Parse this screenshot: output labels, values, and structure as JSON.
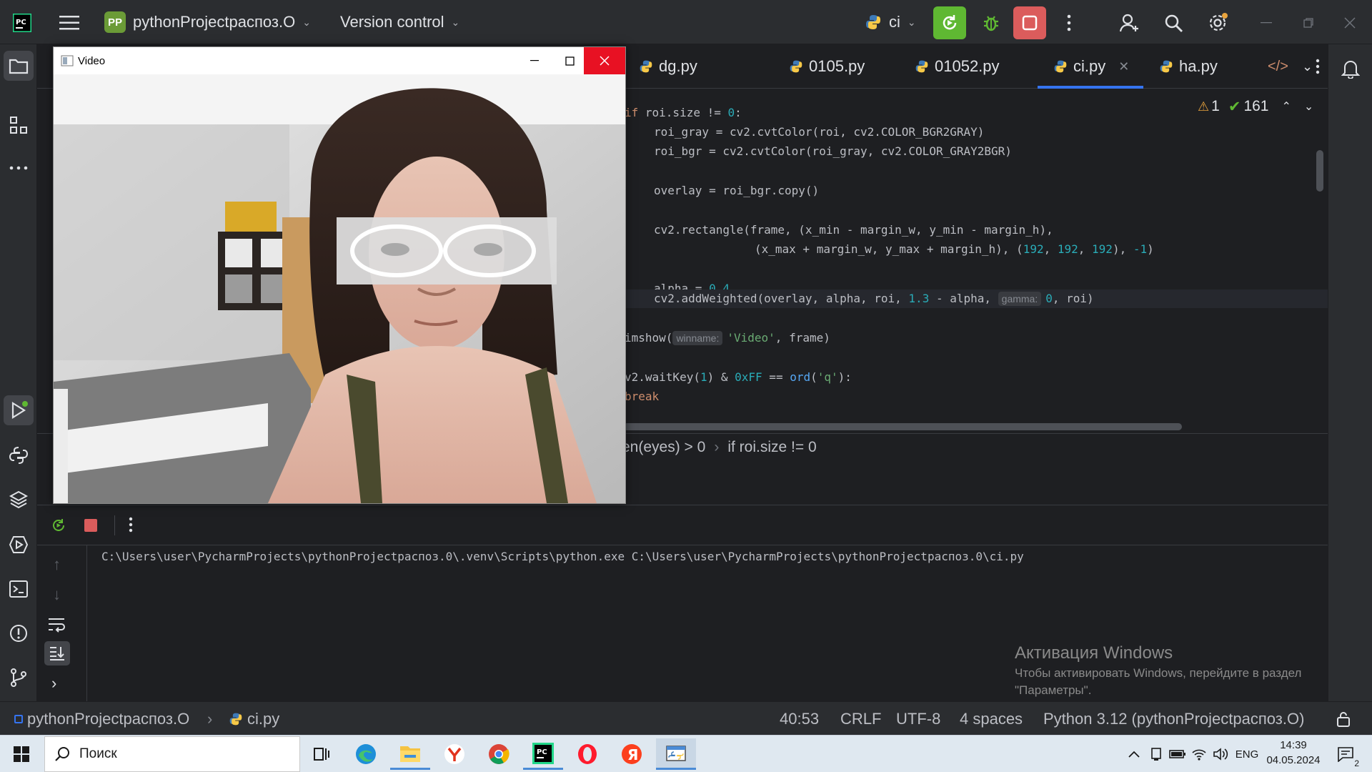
{
  "titlebar": {
    "project_badge": "PP",
    "project_name": "pythonProjectраспоз.О",
    "vcs_label": "Version control",
    "run_config": "ci"
  },
  "tabs": [
    {
      "label": "dg.py"
    },
    {
      "label": "0105.py"
    },
    {
      "label": "01052.py"
    },
    {
      "label": "ci.py",
      "active": true
    },
    {
      "label": "ha.py"
    }
  ],
  "editor": {
    "warnings": "1",
    "checks": "161",
    "lines": {
      "l1_kw": "if",
      "l1_rest": " roi.size != ",
      "l1_num": "0",
      "l1_end": ":",
      "l2": "roi_gray = cv2.cvtColor(roi, cv2.COLOR_BGR2GRAY)",
      "l3": "roi_bgr = cv2.cvtColor(roi_gray, cv2.COLOR_GRAY2BGR)",
      "l4": "overlay = roi_bgr.copy()",
      "l5": "cv2.rectangle(frame, (x_min - margin_w, y_min - margin_h),",
      "l6_a": "(x_max + margin_w, y_max + margin_h), (",
      "l6_n1": "192",
      "l6_c1": ", ",
      "l6_n2": "192",
      "l6_c2": ", ",
      "l6_n3": "192",
      "l6_c3": "), ",
      "l6_n4": "-1",
      "l6_end": ")",
      "l7_a": "alpha = ",
      "l7_num": "0.4",
      "l8_a": "cv2.addWeighted(overlay, alpha, roi, ",
      "l8_num": "1.3",
      "l8_b": " - alpha, ",
      "l8_hint": "gamma:",
      "l8_num2": "0",
      "l8_end": ", roi)",
      "l9_a": "imshow(",
      "l9_hint": "winname:",
      "l9_str": "'Video'",
      "l9_end": ", frame)",
      "l10_a": "v2.waitKey(",
      "l10_num": "1",
      "l10_b": ") & ",
      "l10_hex": "0xFF",
      "l10_c": " == ",
      "l10_fn": "ord",
      "l10_d": "(",
      "l10_str": "'q'",
      "l10_end": "):",
      "l11": "break"
    },
    "breadcrumb_1": "en(eyes) > 0",
    "breadcrumb_sep": "›",
    "breadcrumb_2": "if roi.size != 0"
  },
  "console": {
    "command": "C:\\Users\\user\\PycharmProjects\\pythonProjectраспоз.0\\.venv\\Scripts\\python.exe C:\\Users\\user\\PycharmProjects\\pythonProjectраспоз.0\\ci.py"
  },
  "activation": {
    "title": "Активация Windows",
    "line1": "Чтобы активировать Windows, перейдите в раздел",
    "line2": "\"Параметры\"."
  },
  "statusbar": {
    "project": "pythonProjectраспоз.О",
    "file": "ci.py",
    "position": "40:53",
    "line_sep": "CRLF",
    "encoding": "UTF-8",
    "indent": "4 spaces",
    "interpreter": "Python 3.12 (pythonProjectраспоз.O)"
  },
  "video_window": {
    "title": "Video"
  },
  "taskbar": {
    "search_placeholder": "Поиск",
    "lang": "ENG",
    "time": "14:39",
    "date": "04.05.2024",
    "notifications": "2"
  },
  "colors": {
    "accent_green": "#5fb832",
    "stop_red": "#db5c5c",
    "close_red": "#e81123"
  }
}
